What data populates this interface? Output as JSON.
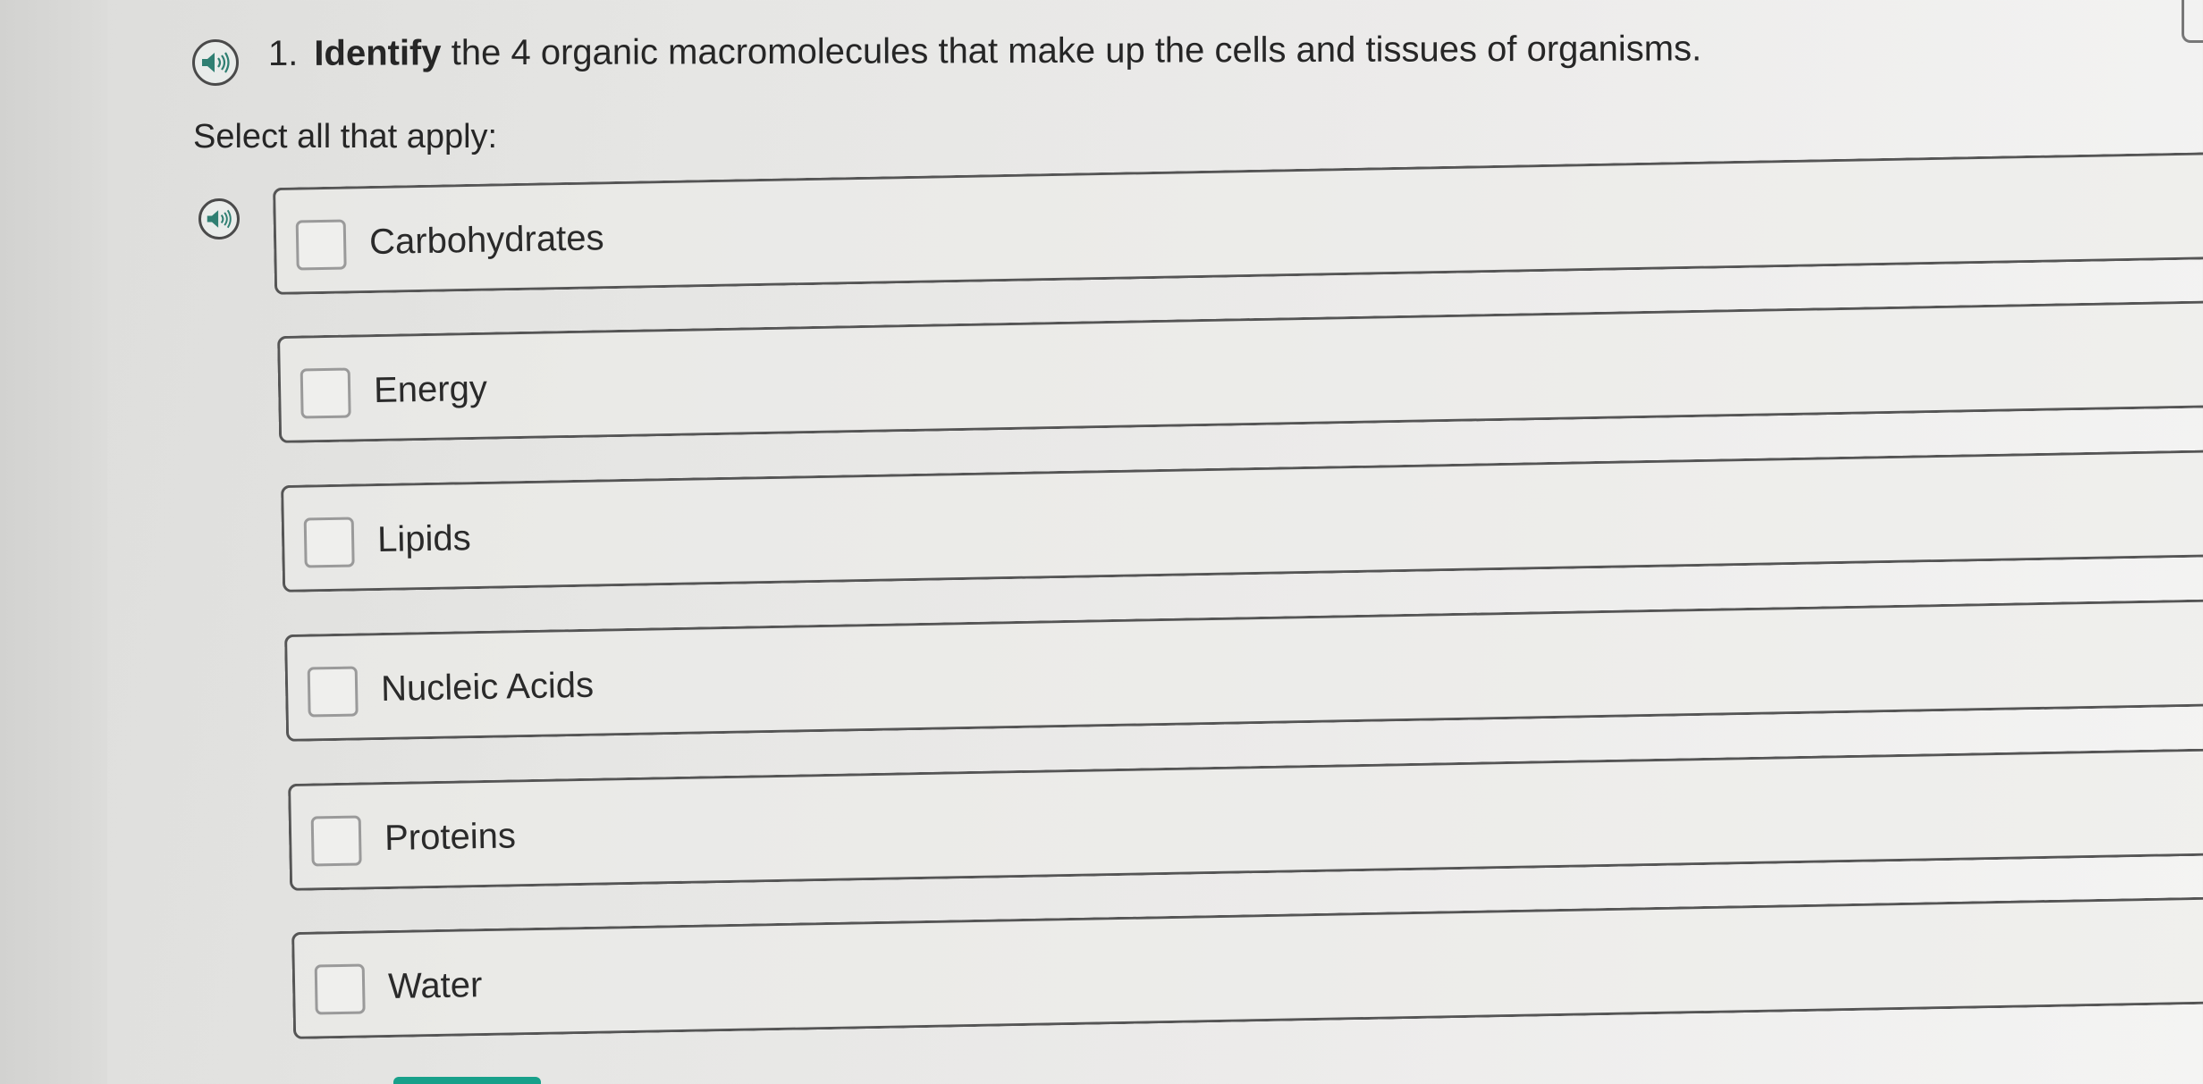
{
  "question": {
    "number": "1.",
    "bold_word": "Identify",
    "rest": " the 4 organic macromolecules that make up the cells and tissues of organisms."
  },
  "instruction": "Select all that apply:",
  "options": [
    {
      "label": "Carbohydrates",
      "checked": false
    },
    {
      "label": "Energy",
      "checked": false
    },
    {
      "label": "Lipids",
      "checked": false
    },
    {
      "label": "Nucleic Acids",
      "checked": false
    },
    {
      "label": "Proteins",
      "checked": false
    },
    {
      "label": "Water",
      "checked": false
    }
  ],
  "icons": {
    "question_audio": "speaker-icon",
    "option_audio": "speaker-icon"
  },
  "colors": {
    "accent": "#18a08a",
    "text": "#262626"
  }
}
